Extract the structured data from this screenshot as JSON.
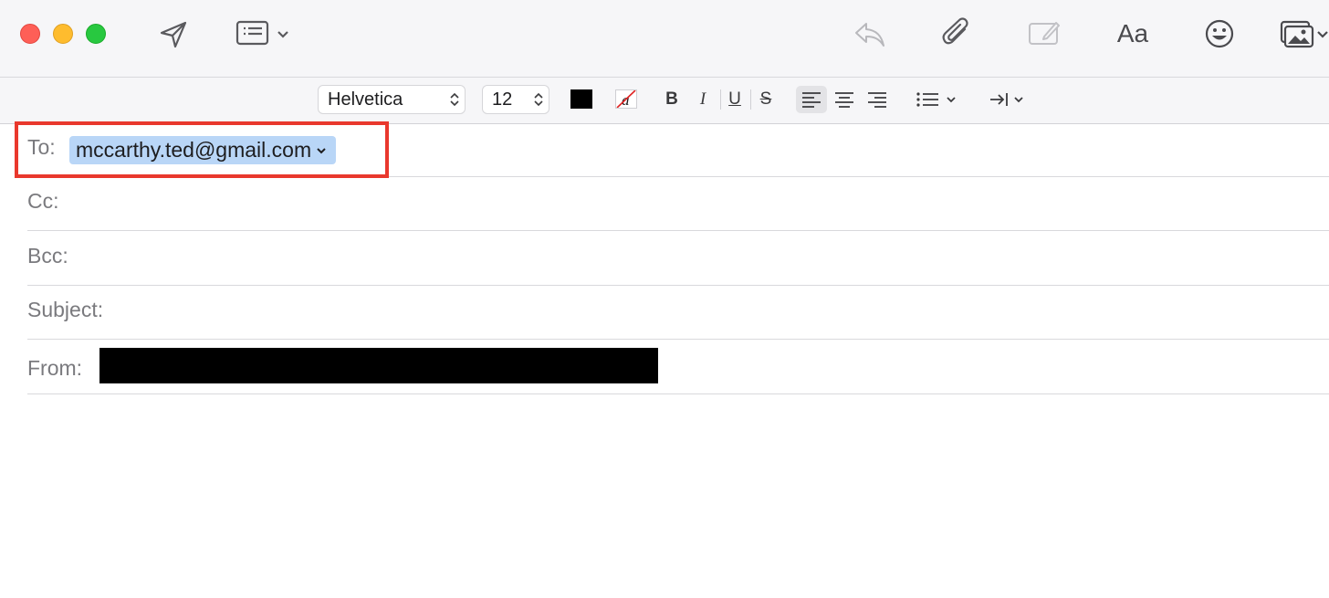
{
  "window": {
    "traffic_lights": [
      "close",
      "minimize",
      "zoom"
    ],
    "colors": {
      "close": "#fe5f57",
      "minimize": "#febc2e",
      "zoom": "#28c840"
    }
  },
  "toolbar": {
    "icons": [
      "send-icon",
      "header-fields-icon",
      "reply-icon",
      "attachment-icon",
      "markup-icon",
      "format-icon",
      "emoji-icon",
      "photo-browser-icon"
    ],
    "format_label": "Aa"
  },
  "format_bar": {
    "font_name": "Helvetica",
    "font_size": "12",
    "text_color": "#000000",
    "bold_label": "B",
    "italic_label": "I",
    "underline_label": "U",
    "strikethrough_label": "S",
    "alignment": "left"
  },
  "fields": {
    "to_label": "To:",
    "to_recipient": "mccarthy.ted@gmail.com",
    "cc_label": "Cc:",
    "bcc_label": "Bcc:",
    "subject_label": "Subject:",
    "from_label": "From:"
  },
  "accent": {
    "highlight": "#e9382d",
    "token": "#b9d6f7"
  }
}
